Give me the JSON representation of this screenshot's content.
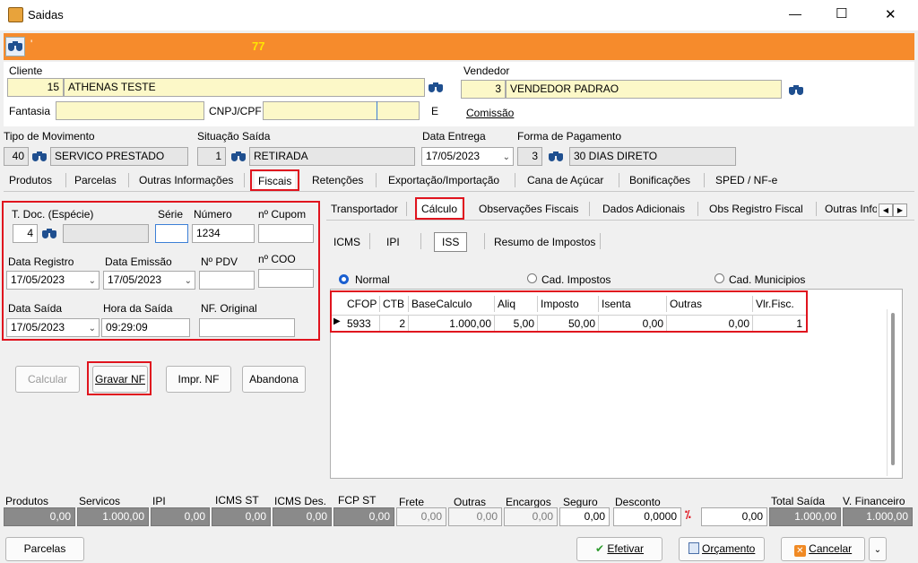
{
  "window": {
    "title": "Saidas",
    "minimize": "—",
    "maximize": "☐",
    "close": "✕"
  },
  "toolbar": {
    "number": "77",
    "mark": "'"
  },
  "cliente": {
    "label": "Cliente",
    "code": "15",
    "name": "ATHENAS TESTE"
  },
  "fantasia": {
    "label": "Fantasia",
    "value": ""
  },
  "cnpj": {
    "label": "CNPJ/CPF",
    "value": "",
    "e_label": "E"
  },
  "vendedor": {
    "label": "Vendedor",
    "code": "3",
    "name": "VENDEDOR PADRAO",
    "comissao_label": "Comissão"
  },
  "movimento": {
    "label": "Tipo  de Movimento",
    "code": "40",
    "name": "SERVICO PRESTADO"
  },
  "situacao": {
    "label": "Situação Saída",
    "code": "1",
    "name": "RETIRADA"
  },
  "data_entrega": {
    "label": "Data Entrega",
    "value": "17/05/2023"
  },
  "pagamento": {
    "label": "Forma de Pagamento",
    "code": "3",
    "name": "30 DIAS DIRETO"
  },
  "main_tabs": [
    "Produtos",
    "Parcelas",
    "Outras Informações",
    "Fiscais",
    "Retenções",
    "Exportação/Importação",
    "Cana de Açúcar",
    "Bonificações",
    "SPED / NF-e"
  ],
  "fiscal": {
    "tdoc_label": "T. Doc. (Espécie)",
    "tdoc_code": "4",
    "tdoc_desc": "",
    "serie_label": "Série",
    "serie_value": "",
    "numero_label": "Número",
    "numero_value": "1234",
    "cupom_label": "nº Cupom",
    "cupom_value": "",
    "data_registro_label": "Data Registro",
    "data_registro_value": "17/05/2023",
    "data_emissao_label": "Data Emissão",
    "data_emissao_value": "17/05/2023",
    "pdv_label": "Nº PDV",
    "pdv_value": "",
    "coo_label": "nº COO",
    "coo_value": "",
    "data_saida_label": "Data Saída",
    "data_saida_value": "17/05/2023",
    "hora_saida_label": "Hora da Saída",
    "hora_saida_value": "09:29:09",
    "nf_original_label": "NF. Original",
    "nf_original_value": ""
  },
  "buttons": {
    "calcular": "Calcular",
    "gravar": "Gravar NF",
    "imprimir": "Impr. NF",
    "abandona": "Abandona"
  },
  "sub_tabs": [
    "Transportador",
    "Cálculo",
    "Observações Fiscais",
    "Dados Adicionais",
    "Obs Registro Fiscal",
    "Outras Info"
  ],
  "tax_tabs": [
    "ICMS",
    "IPI",
    "ISS",
    "Resumo de Impostos"
  ],
  "radios": {
    "normal": "Normal",
    "cad_impostos": "Cad. Impostos",
    "cad_municipios": "Cad. Municipios"
  },
  "grid": {
    "headers": [
      "CFOP",
      "CTB",
      "BaseCalculo",
      "Aliq",
      "Imposto",
      "Isenta",
      "Outras",
      "Vlr.Fisc."
    ],
    "row": [
      "5933",
      "2",
      "1.000,00",
      "5,00",
      "50,00",
      "0,00",
      "0,00",
      "1"
    ]
  },
  "totals": {
    "produtos_label": "Produtos",
    "produtos": "0,00",
    "servicos_label": "Servicos",
    "servicos": "1.000,00",
    "ipi_label": "IPI",
    "ipi": "0,00",
    "icms_st_label": "ICMS ST",
    "icms_st": "0,00",
    "icms_des_label": "ICMS Des.",
    "icms_des": "0,00",
    "fcp_st_label": "FCP ST",
    "fcp_st": "0,00",
    "frete_label": "Frete",
    "frete": "0,00",
    "outras_label": "Outras",
    "outras": "0,00",
    "encargos_label": "Encargos",
    "encargos": "0,00",
    "seguro_label": "Seguro",
    "seguro": "0,00",
    "desconto_label": "Desconto",
    "desconto_pct": "0,0000",
    "desconto_val": "0,00",
    "total_saida_label": "Total Saída",
    "total_saida": "1.000,00",
    "vfin_label": "V. Financeiro",
    "vfin": "1.000,00"
  },
  "footer": {
    "parcelas": "Parcelas",
    "efetivar": "Efetivar",
    "orcamento": "Orçamento",
    "cancelar": "Cancelar"
  },
  "colors": {
    "toolbar": "#f68b2c",
    "highlight": "#e0141e",
    "yellow_field": "#fcf8c8"
  }
}
